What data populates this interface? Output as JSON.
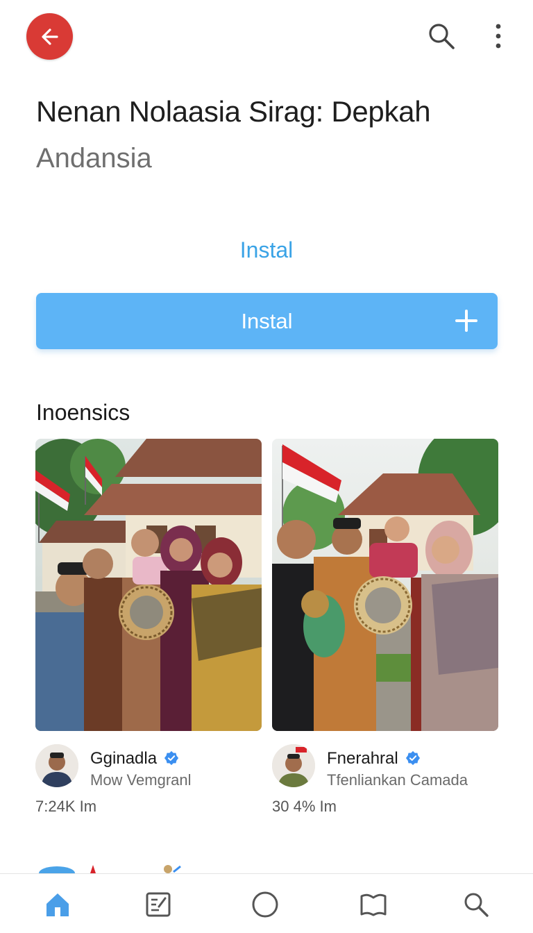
{
  "header": {
    "back_icon": "arrow-left-icon",
    "search_icon": "search-icon",
    "more_icon": "more-vertical-icon",
    "accent_back": "#d93a35"
  },
  "app": {
    "title": "Nenan Nolaasia Sirag: Depkah",
    "developer": "Andansia"
  },
  "install": {
    "link_label": "Instal",
    "button_label": "Instal",
    "button_icon": "plus-icon",
    "button_color": "#5db4f6",
    "link_color": "#3aa3e6"
  },
  "section": {
    "title": "Inoensics"
  },
  "cards": [
    {
      "author": "Gginadla",
      "verified_icon": "verified-badge-icon",
      "subtitle": "Mow Vemgranl",
      "meta": "7:24K Im"
    },
    {
      "author": "Fnerahral",
      "verified_icon": "verified-badge-icon",
      "subtitle": "Tfenliankan Camada",
      "meta": "30 4% Im"
    }
  ],
  "bottom_nav": [
    {
      "icon": "home-icon",
      "active": true
    },
    {
      "icon": "edit-note-icon",
      "active": false
    },
    {
      "icon": "circle-icon",
      "active": false
    },
    {
      "icon": "book-icon",
      "active": false
    },
    {
      "icon": "search-icon",
      "active": false
    }
  ],
  "colors": {
    "active_nav": "#4a9ee8",
    "inactive_nav": "#555555",
    "verified": "#3b8ff0"
  }
}
